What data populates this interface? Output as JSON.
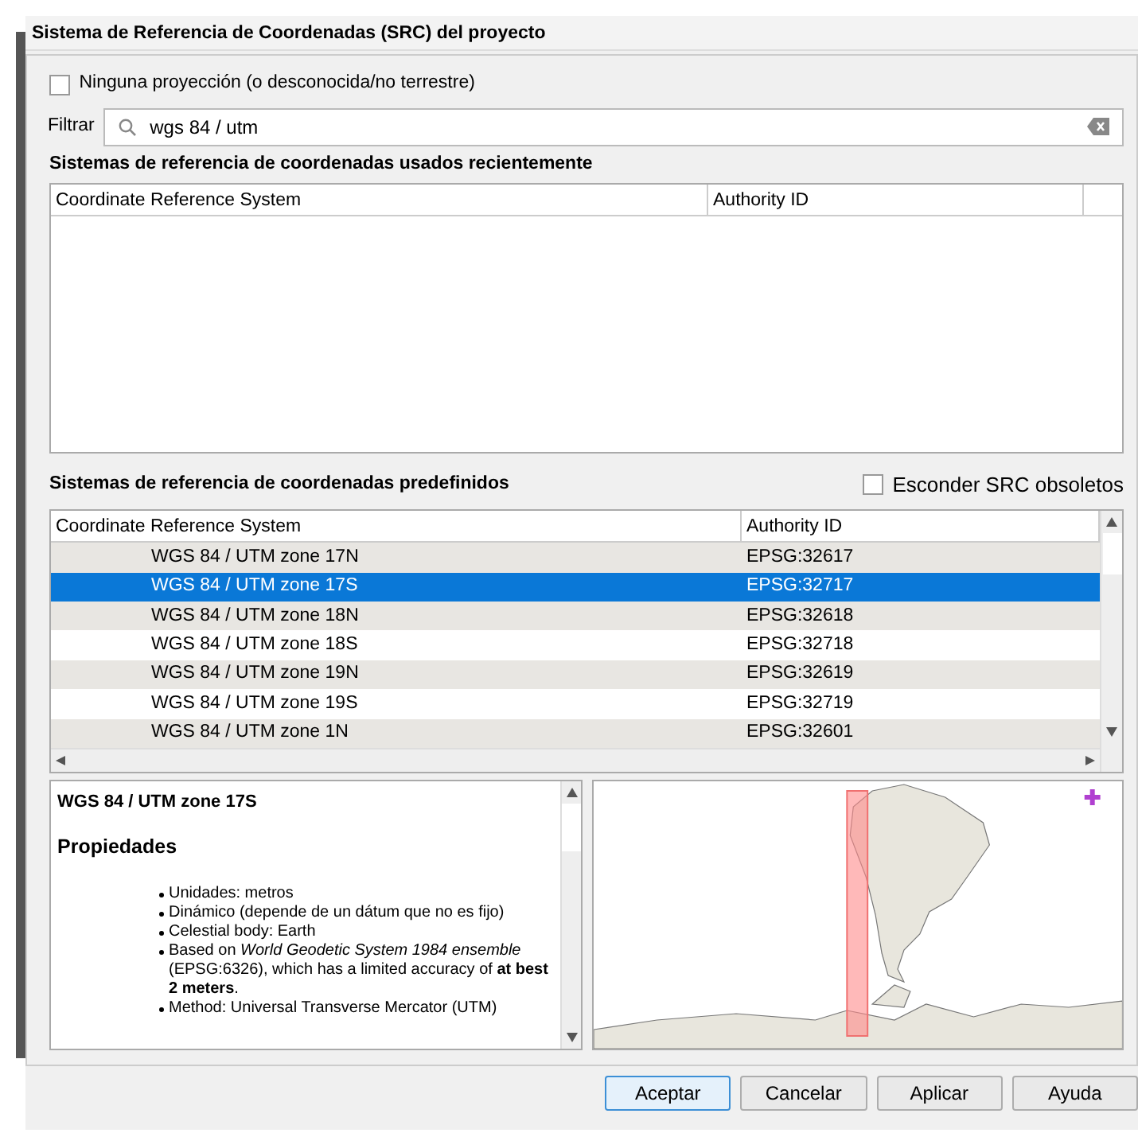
{
  "dialog": {
    "title": "Sistema de Referencia de Coordenadas (SRC) del proyecto"
  },
  "no_projection": {
    "label": "Ninguna proyección (o desconocida/no terrestre)",
    "checked": false
  },
  "filter": {
    "label": "Filtrar",
    "value": "wgs 84 / utm"
  },
  "recent": {
    "heading": "Sistemas de referencia de coordenadas usados recientemente",
    "columns": [
      "Coordinate Reference System",
      "Authority ID"
    ]
  },
  "predefined": {
    "heading": "Sistemas de referencia de coordenadas predefinidos",
    "hide_deprecated": {
      "label": "Esconder SRC obsoletos",
      "checked": false
    },
    "columns": [
      "Coordinate Reference System",
      "Authority ID"
    ],
    "rows": [
      {
        "name": "WGS 84 / UTM zone 17N",
        "authority_id": "EPSG:32617",
        "selected": false
      },
      {
        "name": "WGS 84 / UTM zone 17S",
        "authority_id": "EPSG:32717",
        "selected": true
      },
      {
        "name": "WGS 84 / UTM zone 18N",
        "authority_id": "EPSG:32618",
        "selected": false
      },
      {
        "name": "WGS 84 / UTM zone 18S",
        "authority_id": "EPSG:32718",
        "selected": false
      },
      {
        "name": "WGS 84 / UTM zone 19N",
        "authority_id": "EPSG:32619",
        "selected": false
      },
      {
        "name": "WGS 84 / UTM zone 19S",
        "authority_id": "EPSG:32719",
        "selected": false
      },
      {
        "name": "WGS 84 / UTM zone 1N",
        "authority_id": "EPSG:32601",
        "selected": false
      }
    ]
  },
  "details": {
    "title": "WGS 84 / UTM zone 17S",
    "heading": "Propiedades",
    "items": [
      "Unidades: metros",
      "Dinámico (depende de un dátum que no es fijo)",
      "Celestial body: Earth",
      "Based on *World Geodetic System 1984 ensemble* (EPSG:6326), which has a limited accuracy of **at best 2 meters**.",
      "Method: Universal Transverse Mercator (UTM)"
    ]
  },
  "buttons": [
    {
      "label": "Aceptar",
      "default": true
    },
    {
      "label": "Cancelar",
      "default": false
    },
    {
      "label": "Aplicar",
      "default": false
    },
    {
      "label": "Ayuda",
      "default": false
    }
  ]
}
